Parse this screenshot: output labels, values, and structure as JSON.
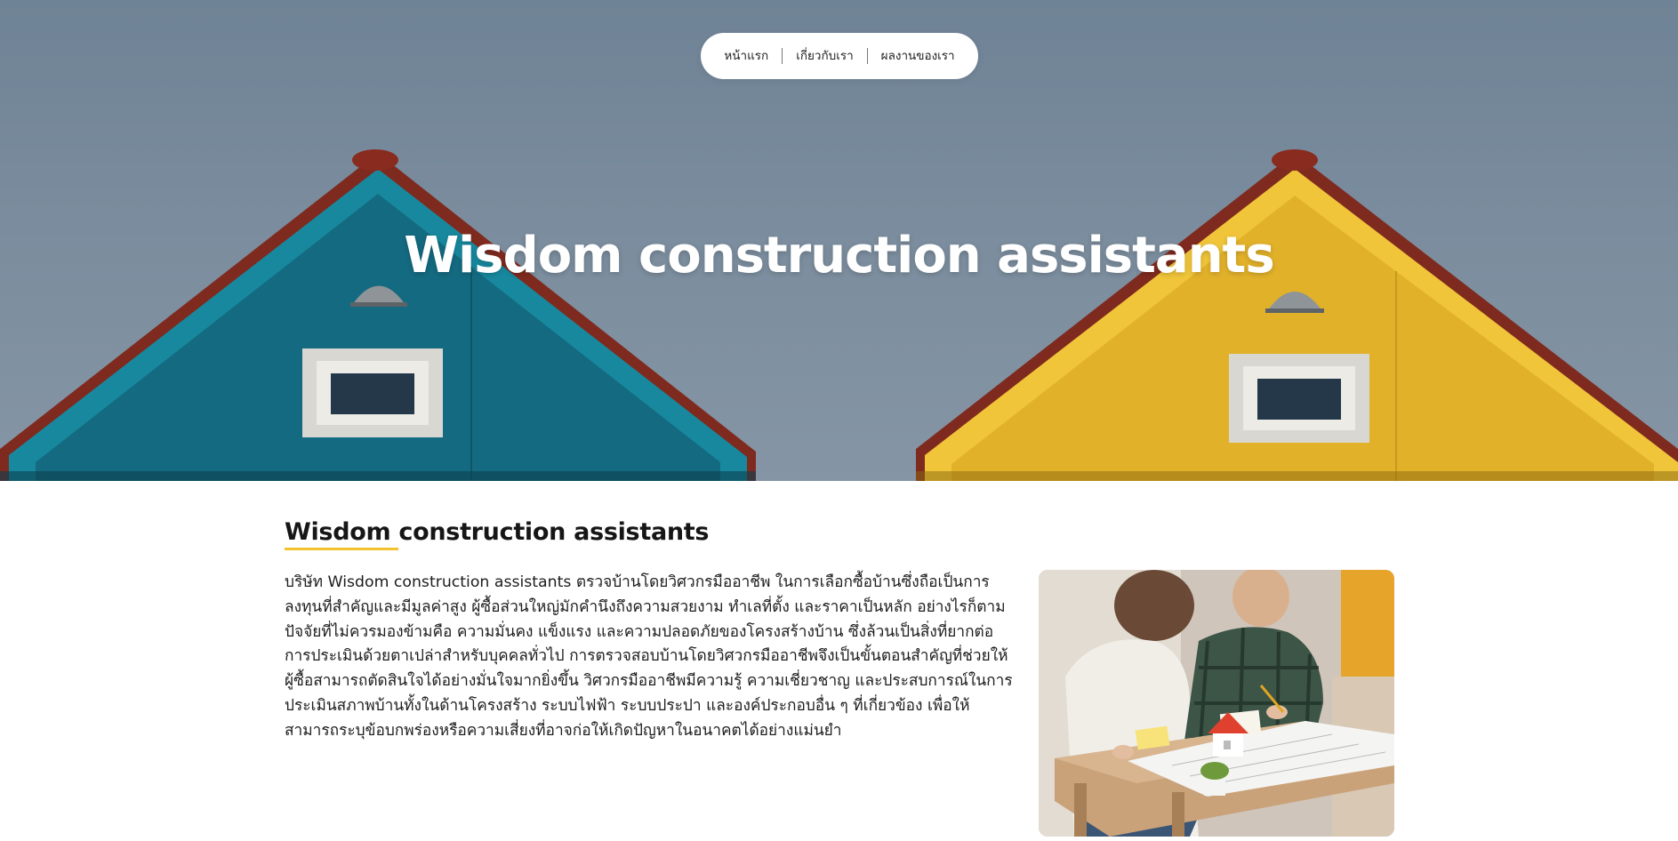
{
  "nav": {
    "items": [
      {
        "label": "หน้าแรก"
      },
      {
        "label": "เกี่ยวกับเรา"
      },
      {
        "label": "ผลงานของเรา"
      }
    ]
  },
  "hero": {
    "title": "Wisdom construction assistants"
  },
  "about": {
    "title": "Wisdom construction assistants",
    "body": "บริษัท Wisdom construction assistants ตรวจบ้านโดยวิศวกรมืออาชีพ ในการเลือกซื้อบ้านซึ่งถือเป็นการลงทุนที่สำคัญและมีมูลค่าสูง ผู้ซื้อส่วนใหญ่มักคำนึงถึงความสวยงาม ทำเลที่ตั้ง และราคาเป็นหลัก อย่างไรก็ตาม ปัจจัยที่ไม่ควรมองข้ามคือ ความมั่นคง แข็งแรง และความปลอดภัยของโครงสร้างบ้าน ซึ่งล้วนเป็นสิ่งที่ยากต่อการประเมินด้วยตาเปล่าสำหรับบุคคลทั่วไป การตรวจสอบบ้านโดยวิศวกรมืออาชีพจึงเป็นขั้นตอนสำคัญที่ช่วยให้ผู้ซื้อสามารถตัดสินใจได้อย่างมั่นใจมากยิ่งขึ้น วิศวกรมืออาชีพมีความรู้ ความเชี่ยวชาญ และประสบการณ์ในการประเมินสภาพบ้านทั้งในด้านโครงสร้าง ระบบไฟฟ้า ระบบประปา และองค์ประกอบอื่น ๆ ที่เกี่ยวข้อง เพื่อให้สามารถระบุข้อบกพร่องหรือความเสี่ยงที่อาจก่อให้เกิดปัญหาในอนาคตได้อย่างแม่นยำ"
  },
  "colors": {
    "accent": "#f2c230",
    "sky": "#7a8c9d",
    "house_left": "#1a6f86",
    "house_right": "#e2b42a",
    "roof": "#8a2b1f"
  },
  "icons": {
    "hero_image": "two-houses-image",
    "about_image": "couple-planning-house-image"
  }
}
